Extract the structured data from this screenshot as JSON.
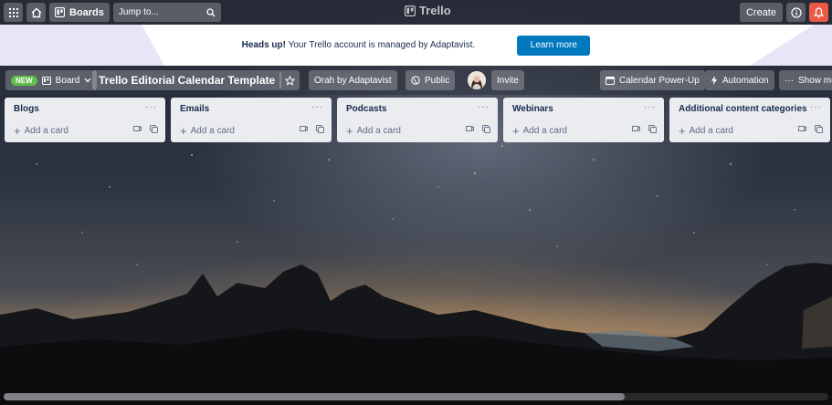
{
  "header": {
    "boards_label": "Boards",
    "jump_placeholder": "Jump to...",
    "brand": "Trello",
    "create_label": "Create"
  },
  "banner": {
    "heading": "Heads up!",
    "message": " Your Trello account is managed by Adaptavist.",
    "cta_label": "Learn more"
  },
  "board": {
    "new_badge": "NEW",
    "view_label": "Board",
    "title": "Trello Editorial Calendar Template",
    "workspace_label": "Orah by Adaptavist",
    "visibility_label": "Public",
    "invite_label": "Invite",
    "calendar_label": "Calendar Power-Up",
    "automation_label": "Automation",
    "show_menu_label": "Show me"
  },
  "lists": [
    {
      "title": "Blogs",
      "add_label": "Add a card"
    },
    {
      "title": "Emails",
      "add_label": "Add a card"
    },
    {
      "title": "Podcasts",
      "add_label": "Add a card"
    },
    {
      "title": "Webinars",
      "add_label": "Add a card"
    },
    {
      "title": "Additional content categories",
      "add_label": "Add a card"
    }
  ],
  "colors": {
    "banner_cta": "#0079bf",
    "new_badge": "#61bd4f",
    "notification": "#eb5a46",
    "list_bg": "#ebecf0"
  }
}
